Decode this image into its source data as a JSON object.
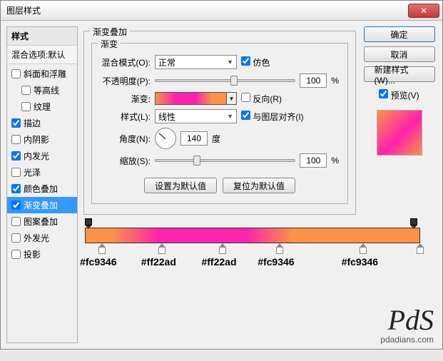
{
  "dialog": {
    "title": "图层样式"
  },
  "styles": {
    "header": "样式",
    "blend_defaults": "混合选项:默认",
    "items": [
      {
        "label": "斜面和浮雕",
        "checked": false,
        "indent": 0
      },
      {
        "label": "等高线",
        "checked": false,
        "indent": 1
      },
      {
        "label": "纹理",
        "checked": false,
        "indent": 1
      },
      {
        "label": "描边",
        "checked": true,
        "indent": 0
      },
      {
        "label": "内阴影",
        "checked": false,
        "indent": 0
      },
      {
        "label": "内发光",
        "checked": true,
        "indent": 0
      },
      {
        "label": "光泽",
        "checked": false,
        "indent": 0
      },
      {
        "label": "颜色叠加",
        "checked": true,
        "indent": 0
      },
      {
        "label": "渐变叠加",
        "checked": true,
        "indent": 0,
        "selected": true
      },
      {
        "label": "图案叠加",
        "checked": false,
        "indent": 0
      },
      {
        "label": "外发光",
        "checked": false,
        "indent": 0
      },
      {
        "label": "投影",
        "checked": false,
        "indent": 0
      }
    ]
  },
  "overlay": {
    "group_title": "渐变叠加",
    "inner_title": "渐变",
    "blend_mode_label": "混合模式(O):",
    "blend_mode_value": "正常",
    "dither_label": "仿色",
    "dither": true,
    "opacity_label": "不透明度(P):",
    "opacity_value": "100",
    "percent": "%",
    "gradient_label": "渐变:",
    "reverse_label": "反向(R)",
    "reverse": false,
    "style_label": "样式(L):",
    "style_value": "线性",
    "align_label": "与图层对齐(I)",
    "align": true,
    "angle_label": "角度(N):",
    "angle_value": "140",
    "degree": "度",
    "scale_label": "缩放(S):",
    "scale_value": "100",
    "reset_btn": "设置为默认值",
    "revert_btn": "复位为默认值"
  },
  "right": {
    "ok": "确定",
    "cancel": "取消",
    "new_style": "新建样式(W)...",
    "preview_label": "预览(V)",
    "preview": true
  },
  "gradient_stops": {
    "colors": [
      {
        "pos": 4,
        "hex": "#fc9346"
      },
      {
        "pos": 22,
        "hex": "#ff22ad"
      },
      {
        "pos": 40,
        "hex": "#ff22ad"
      },
      {
        "pos": 57,
        "hex": "#fc9346"
      },
      {
        "pos": 82,
        "hex": "#fc9346"
      },
      {
        "pos": 99,
        "hex": ""
      }
    ],
    "opacity": [
      {
        "pos": 0
      },
      {
        "pos": 97
      }
    ]
  },
  "watermark": {
    "logo": "PdS",
    "url": "pdadians.com"
  }
}
